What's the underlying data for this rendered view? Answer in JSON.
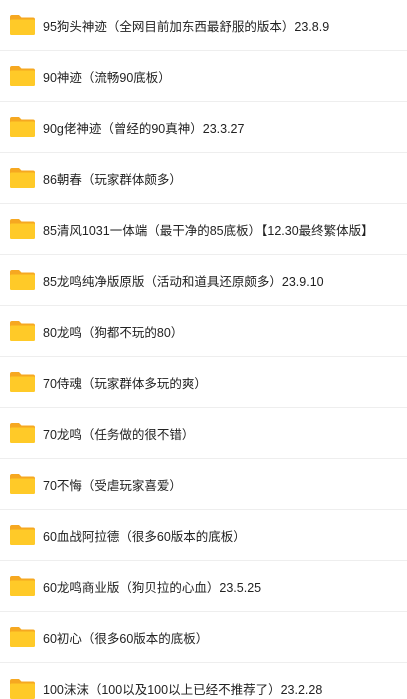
{
  "folders": [
    {
      "name": "95狗头神迹（全网目前加东西最舒服的版本）23.8.9",
      "icon": "folder-icon"
    },
    {
      "name": "90神迹（流畅90底板）",
      "icon": "folder-icon"
    },
    {
      "name": "90g佬神迹（曾经的90真神）23.3.27",
      "icon": "folder-icon"
    },
    {
      "name": "86朝春（玩家群体颇多）",
      "icon": "folder-icon"
    },
    {
      "name": "85清风1031一体端（最干净的85底板）【12.30最终繁体版】",
      "icon": "folder-icon"
    },
    {
      "name": "85龙鸣纯净版原版（活动和道具还原颇多）23.9.10",
      "icon": "folder-icon"
    },
    {
      "name": "80龙鸣（狗都不玩的80）",
      "icon": "folder-icon"
    },
    {
      "name": "70侍魂（玩家群体多玩的爽）",
      "icon": "folder-icon"
    },
    {
      "name": "70龙鸣（任务做的很不错）",
      "icon": "folder-icon"
    },
    {
      "name": "70不悔（受虐玩家喜爱）",
      "icon": "folder-icon"
    },
    {
      "name": "60血战阿拉德（很多60版本的底板）",
      "icon": "folder-icon"
    },
    {
      "name": "60龙鸣商业版（狗贝拉的心血）23.5.25",
      "icon": "folder-icon"
    },
    {
      "name": "60初心（很多60版本的底板）",
      "icon": "folder-icon"
    },
    {
      "name": "100沫沫（100以及100以上已经不推荐了）23.2.28",
      "icon": "folder-icon"
    }
  ],
  "colors": {
    "folder_front": "#FFCA28",
    "folder_back": "#F6A821",
    "text": "#222222",
    "divider": "#eeeeee"
  }
}
